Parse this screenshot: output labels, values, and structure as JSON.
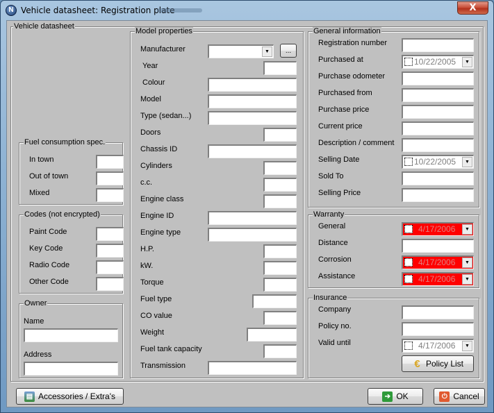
{
  "window": {
    "title": "Vehicle datasheet: Registration plate",
    "close_glyph": "X",
    "app_icon_glyph": "N"
  },
  "groups": {
    "vehicle": "Vehicle datasheet",
    "fuel": "Fuel consumption spec.",
    "codes": "Codes (not encrypted)",
    "owner": "Owner",
    "model": "Model properties",
    "general": "General information",
    "warranty": "Warranty",
    "insurance": "Insurance"
  },
  "fuel": {
    "in_town": "In town",
    "out_of_town": "Out of town",
    "mixed": "Mixed"
  },
  "codes": {
    "paint": "Paint Code",
    "key": "Key Code",
    "radio": "Radio Code",
    "other": "Other Code"
  },
  "owner": {
    "name": "Name",
    "address": "Address"
  },
  "model": {
    "manufacturer": "Manufacturer",
    "browse_button": "...",
    "year": "Year",
    "colour": "Colour",
    "model": "Model",
    "type": "Type (sedan...)",
    "doors": "Doors",
    "chassis": "Chassis ID",
    "cylinders": "Cylinders",
    "cc": "c.c.",
    "engine_class": "Engine class",
    "engine_id": "Engine ID",
    "engine_type": "Engine type",
    "hp": "H.P.",
    "kw": "kW.",
    "torque": "Torque",
    "fuel_type": "Fuel type",
    "co_value": "CO value",
    "weight": "Weight",
    "tank": "Fuel tank capacity",
    "transmission": "Transmission"
  },
  "general": {
    "registration": "Registration number",
    "purchased_at": "Purchased at",
    "purchased_at_value": "10/22/2005",
    "odometer": "Purchase odometer",
    "purchased_from": "Purchased from",
    "purchase_price": "Purchase price",
    "current_price": "Current price",
    "description": "Description / comment",
    "selling_date": "Selling Date",
    "selling_date_value": "10/22/2005",
    "sold_to": "Sold To",
    "selling_price": "Selling Price"
  },
  "warranty": {
    "general": "General",
    "general_value": "4/17/2006",
    "distance": "Distance",
    "corrosion": "Corrosion",
    "corrosion_value": "4/17/2006",
    "assistance": "Assistance",
    "assistance_value": "4/17/2006",
    "expired_color": "#ff0000"
  },
  "insurance": {
    "company": "Company",
    "policy_no": "Policy no.",
    "valid_until": "Valid until",
    "valid_until_value": "4/17/2006",
    "policy_list_button": "Policy List"
  },
  "footer": {
    "accessories_button": "Accessories / Extra's",
    "ok_button": "OK",
    "cancel_button": "Cancel"
  }
}
